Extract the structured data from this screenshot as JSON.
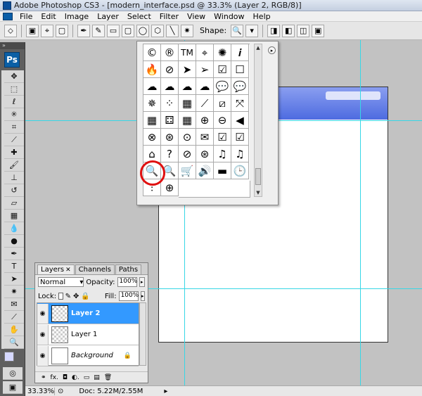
{
  "window": {
    "title": "Adobe Photoshop CS3 - [modern_interface.psd @ 33.3% (Layer 2, RGB/8)]"
  },
  "menu": [
    "File",
    "Edit",
    "Image",
    "Layer",
    "Select",
    "Filter",
    "View",
    "Window",
    "Help"
  ],
  "options_bar": {
    "shape_label": "Shape:"
  },
  "tools": {
    "logo": "Ps",
    "collapse": "»"
  },
  "shape_picker": {
    "cells": [
      "©",
      "®",
      "TM",
      "⌖",
      "✺",
      "𝒊",
      "🔥",
      "⊘",
      "➤",
      "➢",
      "☑",
      "☐",
      "☁",
      "☁",
      "☁",
      "☁",
      "💬",
      "💬",
      "✵",
      "⁘",
      "▦",
      "⟋",
      "⧄",
      "⤧",
      "▦",
      "⚃",
      "▦",
      "⊕",
      "⊖",
      "◀",
      "⊗",
      "⊛",
      "⊙",
      "✉",
      "☑",
      "☑",
      "⌂",
      "?",
      "⊘",
      "⊛",
      "♫",
      "♫",
      "🔍",
      "🔍",
      "🛒",
      "🔊",
      "▬",
      "🕒",
      "⫶",
      "⊕"
    ],
    "menu_arrow": "▸"
  },
  "layers": {
    "tabs": [
      {
        "label": "Layers",
        "close": "✕"
      },
      {
        "label": "Channels"
      },
      {
        "label": "Paths"
      }
    ],
    "blend_mode": "Normal",
    "opacity_label": "Opacity:",
    "opacity": "100%",
    "lock_label": "Lock:",
    "fill_label": "Fill:",
    "fill": "100%",
    "items": [
      {
        "name": "Layer 2"
      },
      {
        "name": "Layer 1"
      },
      {
        "name": "Background"
      }
    ],
    "footer_icons": [
      "⚭",
      "fx.",
      "◘",
      "◐.",
      "▭",
      "▤",
      "🗑"
    ]
  },
  "status": {
    "zoom": "33.33%",
    "doc": "Doc: 5.22M/2.55M"
  },
  "colors": {
    "selection": "#3399ff",
    "guide": "#37d7e6",
    "header_bar": "#4d6be0",
    "highlight": "#e01010"
  }
}
